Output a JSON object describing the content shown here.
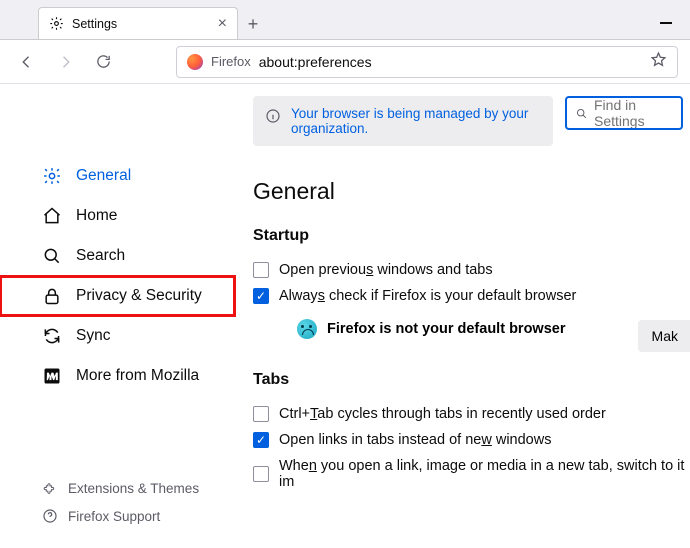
{
  "window": {
    "tab_title": "Settings",
    "identity_label": "Firefox",
    "url": "about:preferences"
  },
  "notice": {
    "text": "Your browser is being managed by your organization."
  },
  "search_input": {
    "placeholder": "Find in Settings"
  },
  "sidebar": {
    "items": [
      {
        "label": "General"
      },
      {
        "label": "Home"
      },
      {
        "label": "Search"
      },
      {
        "label": "Privacy & Security"
      },
      {
        "label": "Sync"
      },
      {
        "label": "More from Mozilla"
      }
    ],
    "links": [
      {
        "label": "Extensions & Themes"
      },
      {
        "label": "Firefox Support"
      }
    ]
  },
  "main": {
    "heading": "General",
    "startup": {
      "heading": "Startup",
      "open_previous": {
        "label": "Open previous windows and tabs",
        "checked": false
      },
      "always_check": {
        "label": "Always check if Firefox is your default browser",
        "checked": true
      },
      "default_status": "Firefox is not your default browser",
      "make_default_label": "Make Default…"
    },
    "tabs": {
      "heading": "Tabs",
      "ctrl_tab": {
        "label": "Ctrl+Tab cycles through tabs in recently used order",
        "checked": false
      },
      "open_links": {
        "label": "Open links in tabs instead of new windows",
        "checked": true
      },
      "switch_new": {
        "label": "When you open a link, image or media in a new tab, switch to it immediately",
        "checked": false
      }
    }
  }
}
